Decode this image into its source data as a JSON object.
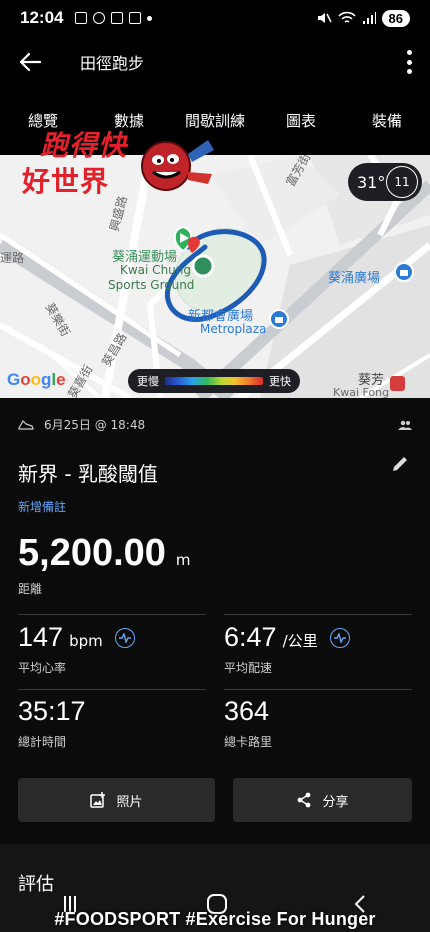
{
  "status_bar": {
    "time": "12:04",
    "battery": "86"
  },
  "app_bar": {
    "title": "田徑跑步"
  },
  "tabs": [
    {
      "label": "總覽",
      "active": true
    },
    {
      "label": "數據"
    },
    {
      "label": "間歇訓練"
    },
    {
      "label": "圖表"
    },
    {
      "label": "裝備"
    }
  ],
  "map": {
    "labels": {
      "street_top": "富芳街",
      "street_left": "興盛路",
      "street_far_left": "運路",
      "venue_cn": "葵涌運動場",
      "venue_en1": "Kwai Chung",
      "venue_en2": "Sports Ground",
      "plaza_cn": "葵涌廣場",
      "metroplaza_cn": "新都會廣場",
      "metroplaza_en": "Metroplaza",
      "street_a": "葵樂街",
      "street_b": "葵昌路",
      "street_c": "葵喜街",
      "station_cn": "葵芳",
      "station_en": "Kwai Fong"
    },
    "google": "Google",
    "legend": {
      "slow": "更慢",
      "fast": "更快"
    },
    "temperature": "31°",
    "wind": "11"
  },
  "sticker": {
    "line1": "跑得快",
    "line2": "好世界"
  },
  "activity": {
    "date": "6月25日 @ 18:48",
    "title": "新界 - 乳酸閾值",
    "add_note": "新增備註",
    "distance_value": "5,200.00",
    "distance_unit": "m",
    "distance_label": "距離"
  },
  "stats": {
    "heart_rate": {
      "value": "147",
      "unit": "bpm",
      "label": "平均心率"
    },
    "pace": {
      "value": "6:47",
      "unit": "/公里",
      "label": "平均配速"
    },
    "time": {
      "value": "35:17",
      "label": "總計時間"
    },
    "calories": {
      "value": "364",
      "label": "總卡路里"
    }
  },
  "buttons": {
    "photos": "照片",
    "share": "分享"
  },
  "section": {
    "title": "評估"
  },
  "watermark": "#FOODSPORT  #Exercise  For Hunger",
  "colors": {
    "accent": "#64a4f4",
    "route": "#1e5bb5",
    "sticker": "#e4202a"
  }
}
